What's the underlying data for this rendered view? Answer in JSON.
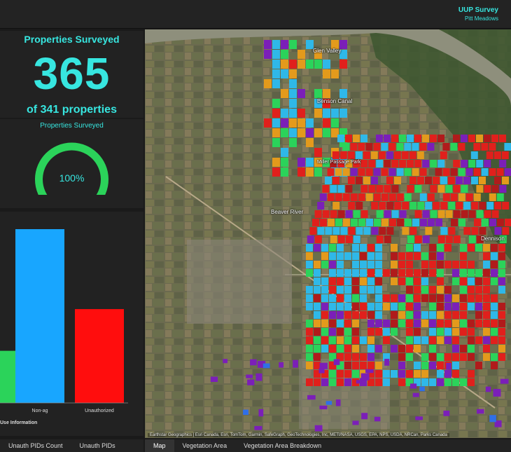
{
  "header": {
    "title": "UUP Survey",
    "subtitle": "Pitt Meadows"
  },
  "indicator": {
    "title": "Properties Surveyed",
    "value": "365",
    "subtitle": "of 341 properties"
  },
  "gauge": {
    "title": "Properties Surveyed",
    "label": "100%",
    "percent": 1.0,
    "color": "#2bd35a"
  },
  "chart_data": {
    "type": "bar",
    "categories": [
      "",
      "Non-ag",
      "Unauthorized"
    ],
    "values": [
      30,
      100,
      54
    ],
    "colors": [
      "#2bd35a",
      "#18a6ff",
      "#ff0d0d"
    ],
    "title": "Use Information",
    "ylim": [
      0,
      100
    ]
  },
  "map": {
    "labels": [
      "Glen Valley",
      "Benson Canal",
      "Beaver River",
      "Dennison",
      "Miller Passage Park"
    ],
    "attribution": "Earthstar Geographics | Esri Canada, Esri, TomTom, Garmin, SafeGraph, GeoTechnologies, Inc, METI/NASA, USGS, EPA, NPS, USDA, NRCan, Parks Canada"
  },
  "tabs_left": [
    "Unauth PIDs Count",
    "Unauth PIDs"
  ],
  "tabs_right": [
    "Map",
    "Vegetation Area",
    "Vegetation Area Breakdown"
  ],
  "colors": {
    "accent": "#37e6e0",
    "green": "#2bd35a",
    "blue": "#18a6ff",
    "red": "#ff0d0d",
    "purple": "#7b1fb8",
    "orange": "#e39a1c",
    "cyan": "#2fb8e8"
  }
}
